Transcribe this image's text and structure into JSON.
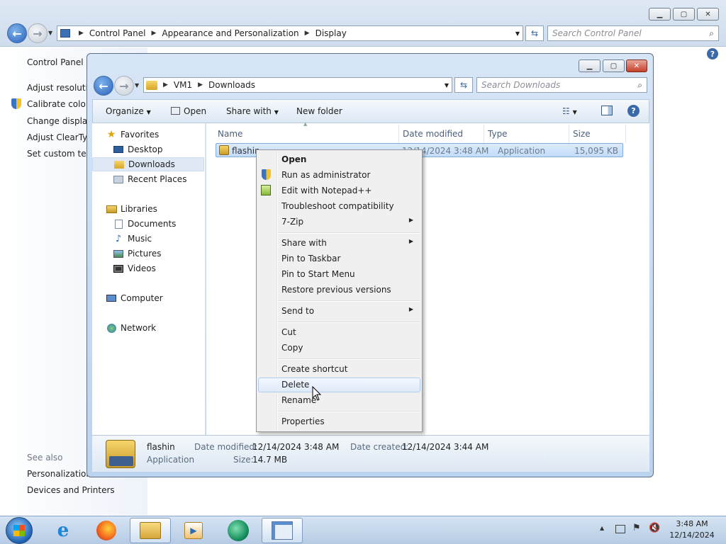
{
  "control_panel": {
    "breadcrumb": [
      "Control Panel",
      "Appearance and Personalization",
      "Display"
    ],
    "search_placeholder": "Search Control Panel",
    "left_links": [
      "Control Panel H",
      "Adjust resolutio",
      "Calibrate color",
      "Change display",
      "Adjust ClearTyp",
      "Set custom text"
    ],
    "see_also_label": "See also",
    "see_also_links": [
      "Personalization",
      "Devices and Printers"
    ]
  },
  "explorer": {
    "breadcrumb": [
      "VM1",
      "Downloads"
    ],
    "search_placeholder": "Search Downloads",
    "toolbar": {
      "organize": "Organize",
      "open": "Open",
      "share_with": "Share with",
      "new_folder": "New folder"
    },
    "nav": {
      "favorites": "Favorites",
      "favorites_items": [
        "Desktop",
        "Downloads",
        "Recent Places"
      ],
      "libraries": "Libraries",
      "libraries_items": [
        "Documents",
        "Music",
        "Pictures",
        "Videos"
      ],
      "computer": "Computer",
      "network": "Network"
    },
    "columns": [
      "Name",
      "Date modified",
      "Type",
      "Size"
    ],
    "file": {
      "name": "flashin",
      "date_modified": "12/14/2024 3:48 AM",
      "type": "Application",
      "size": "15,095 KB"
    },
    "details": {
      "name": "flashin",
      "type": "Application",
      "date_modified_label": "Date modified:",
      "date_modified": "12/14/2024 3:48 AM",
      "date_created_label": "Date created:",
      "date_created": "12/14/2024 3:44 AM",
      "size_label": "Size:",
      "size": "14.7 MB"
    }
  },
  "context_menu": {
    "items": [
      "Open",
      "Run as administrator",
      "Edit with Notepad++",
      "Troubleshoot compatibility",
      "7-Zip",
      "Share with",
      "Pin to Taskbar",
      "Pin to Start Menu",
      "Restore previous versions",
      "Send to",
      "Cut",
      "Copy",
      "Create shortcut",
      "Delete",
      "Rename",
      "Properties"
    ],
    "highlighted": "Delete"
  },
  "taskbar": {
    "time": "3:48 AM",
    "date": "12/14/2024"
  }
}
